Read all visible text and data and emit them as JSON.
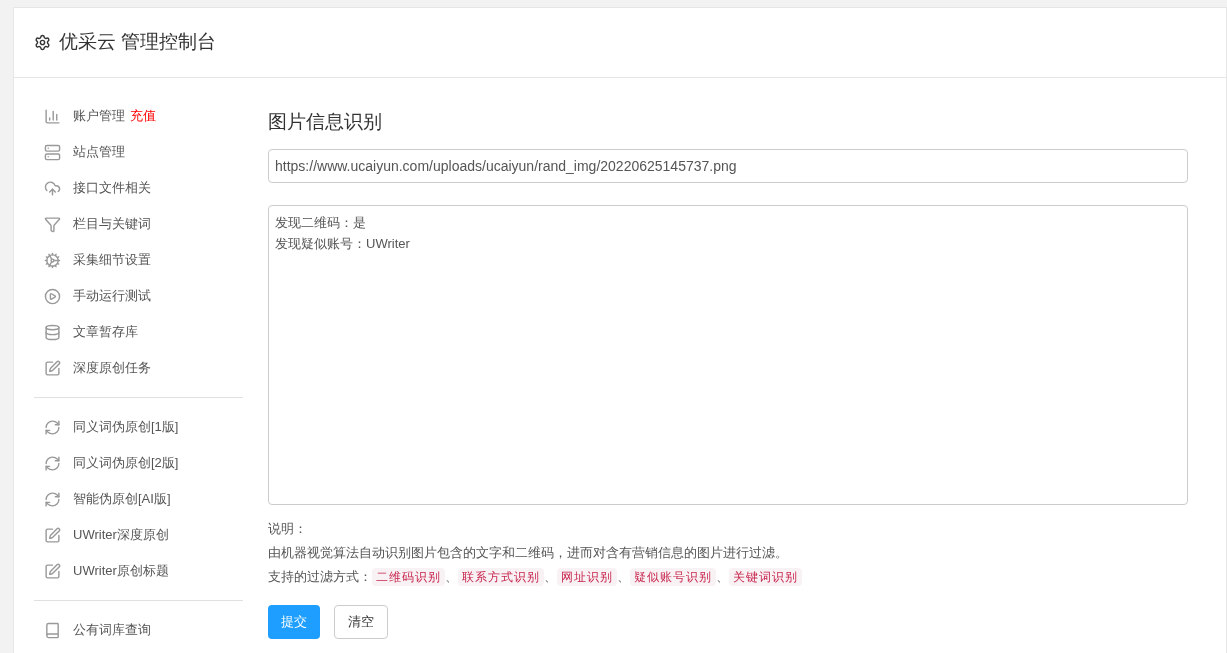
{
  "header": {
    "title": "优采云 管理控制台"
  },
  "sidebar": {
    "groups": [
      [
        {
          "kind": "chart",
          "label": "账户管理",
          "badge": "充值"
        },
        {
          "kind": "server",
          "label": "站点管理"
        },
        {
          "kind": "cloud",
          "label": "接口文件相关"
        },
        {
          "kind": "filter",
          "label": "栏目与关键词"
        },
        {
          "kind": "cogs",
          "label": "采集细节设置"
        },
        {
          "kind": "play",
          "label": "手动运行测试"
        },
        {
          "kind": "database",
          "label": "文章暂存库"
        },
        {
          "kind": "edit",
          "label": "深度原创任务"
        }
      ],
      [
        {
          "kind": "refresh",
          "label": "同义词伪原创[1版]"
        },
        {
          "kind": "refresh",
          "label": "同义词伪原创[2版]"
        },
        {
          "kind": "refresh",
          "label": "智能伪原创[AI版]"
        },
        {
          "kind": "edit",
          "label": "UWriter深度原创"
        },
        {
          "kind": "edit",
          "label": "UWriter原创标题"
        }
      ],
      [
        {
          "kind": "book",
          "label": "公有词库查询"
        }
      ]
    ]
  },
  "main": {
    "title": "图片信息识别",
    "url_field": {
      "value": "https://www.ucaiyun.com/uploads/ucaiyun/rand_img/20220625145737.png"
    },
    "result_box": {
      "lines": [
        "发现二维码：是",
        "发现疑似账号：UWriter"
      ]
    },
    "note_label": "说明：",
    "description": "由机器视觉算法自动识别图片包含的文字和二维码，进而对含有营销信息的图片进行过滤。",
    "filters_label": "支持的过滤方式：",
    "filters": [
      {
        "label": "二维码识别",
        "separator": "、"
      },
      {
        "label": "联系方式识别",
        "separator": "、"
      },
      {
        "label": "网址识别",
        "separator": "、"
      },
      {
        "label": "疑似账号识别",
        "separator": "、"
      },
      {
        "label": "关键词识别"
      }
    ],
    "buttons": [
      {
        "kind": "primary",
        "label": "提交"
      },
      {
        "kind": "default",
        "label": "清空"
      }
    ]
  }
}
